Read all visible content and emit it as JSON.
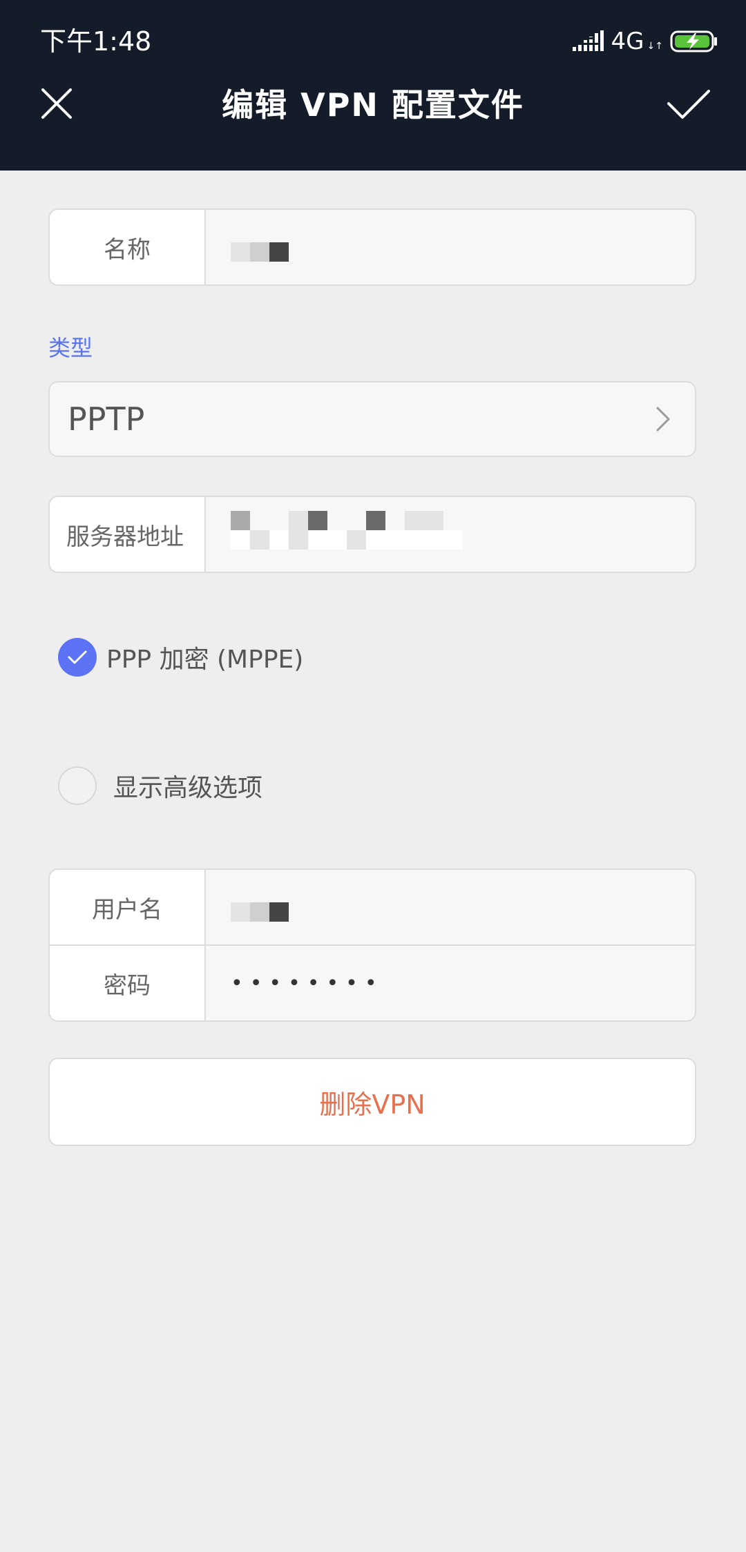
{
  "status_bar": {
    "time": "下午1:48",
    "network": "4G",
    "network_arrows": "↓↑",
    "signal_icon": "signal-bars-icon",
    "battery_icon": "battery-charging-icon",
    "battery_color": "#59c43b"
  },
  "header": {
    "title": "编辑 VPN 配置文件",
    "close_icon": "close-icon",
    "confirm_icon": "checkmark-icon",
    "background": "#141b29"
  },
  "form": {
    "name": {
      "label": "名称"
    },
    "type": {
      "section_label": "类型",
      "value": "PPTP",
      "accent_color": "#5a74f0"
    },
    "server": {
      "label": "服务器地址"
    },
    "ppp_encryption": {
      "label": "PPP 加密 (MPPE)",
      "checked": true,
      "check_color": "#5b73f4"
    },
    "advanced": {
      "label": "显示高级选项",
      "checked": false
    },
    "username": {
      "label": "用户名"
    },
    "password": {
      "label": "密码",
      "value": "••••••••"
    }
  },
  "actions": {
    "delete_label": "删除VPN",
    "delete_color": "#e4714f"
  }
}
